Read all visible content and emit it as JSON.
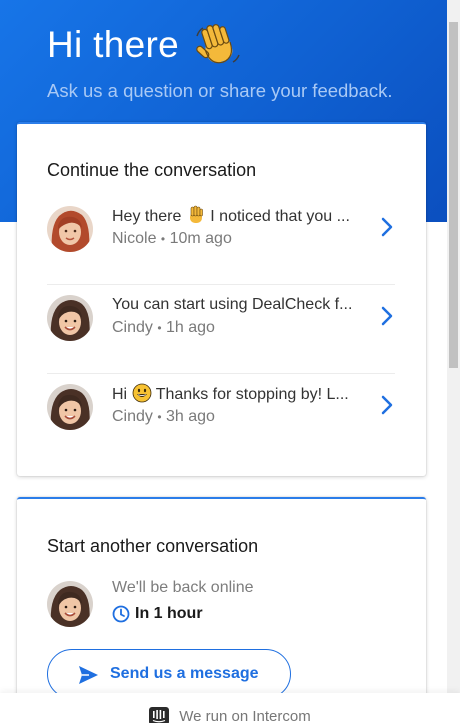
{
  "header": {
    "title": "Hi there",
    "wave_icon": "waving-hand-emoji",
    "subtitle": "Ask us a question or share your feedback."
  },
  "continue_card": {
    "title": "Continue the conversation",
    "conversations": [
      {
        "preview_before": "Hey there",
        "preview_after": "I noticed that you ...",
        "emoji": "waving-hand-emoji",
        "author": "Nicole",
        "separator": "•",
        "time": "10m ago"
      },
      {
        "preview_before": "You can start using DealCheck f...",
        "preview_after": "",
        "emoji": "",
        "author": "Cindy",
        "separator": "•",
        "time": "1h ago"
      },
      {
        "preview_before": "Hi",
        "preview_after": "Thanks for stopping by! L...",
        "emoji": "grinning-face-emoji",
        "author": "Cindy",
        "separator": "•",
        "time": "3h ago"
      }
    ]
  },
  "start_card": {
    "title": "Start another conversation",
    "status": "We'll be back online",
    "eta": "In 1 hour",
    "button_label": "Send us a message"
  },
  "footer": {
    "text": "We run on Intercom"
  },
  "colors": {
    "brand": "#1775e8",
    "accent": "#1f6fe0"
  }
}
